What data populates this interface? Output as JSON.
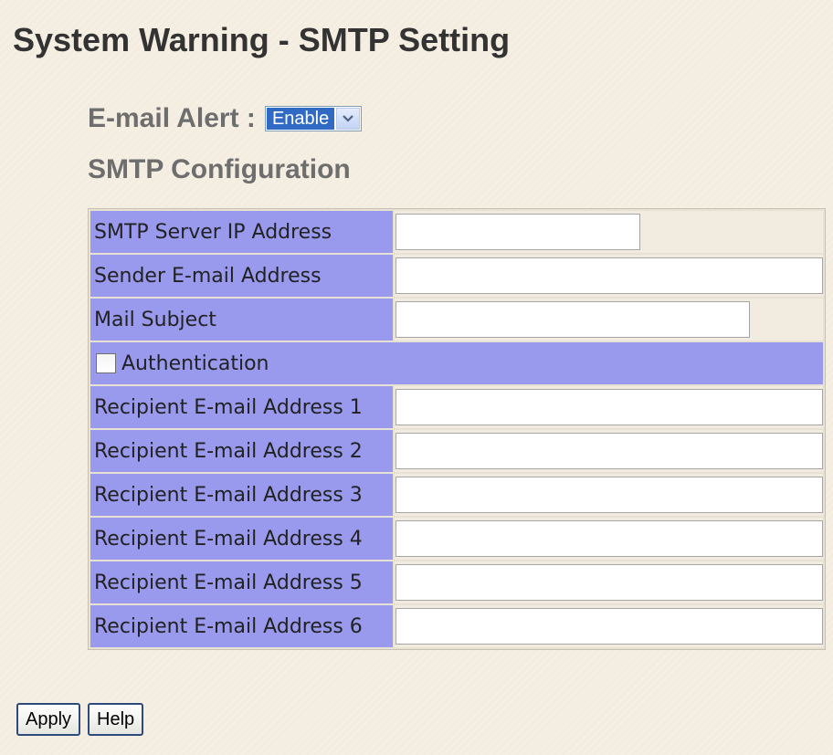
{
  "page": {
    "title": "System Warning - SMTP Setting"
  },
  "email_alert": {
    "label": "E-mail Alert :",
    "selected": "Enable"
  },
  "smtp_config": {
    "title": "SMTP Configuration",
    "server_ip": {
      "label": "SMTP Server IP Address",
      "value": ""
    },
    "sender_email": {
      "label": "Sender E-mail Address",
      "value": ""
    },
    "mail_subject": {
      "label": "Mail Subject",
      "value": ""
    },
    "authentication": {
      "label": "Authentication",
      "checked": false
    },
    "recipients": [
      {
        "label": "Recipient E-mail Address 1",
        "value": ""
      },
      {
        "label": "Recipient E-mail Address 2",
        "value": ""
      },
      {
        "label": "Recipient E-mail Address 3",
        "value": ""
      },
      {
        "label": "Recipient E-mail Address 4",
        "value": ""
      },
      {
        "label": "Recipient E-mail Address 5",
        "value": ""
      },
      {
        "label": "Recipient E-mail Address 6",
        "value": ""
      }
    ]
  },
  "buttons": {
    "apply": "Apply",
    "help": "Help"
  },
  "colors": {
    "label_background": "#9999ee",
    "page_background": "#f5efe3",
    "select_highlight": "#316ac5"
  },
  "icons": {
    "dropdown": "chevron-down-icon"
  }
}
